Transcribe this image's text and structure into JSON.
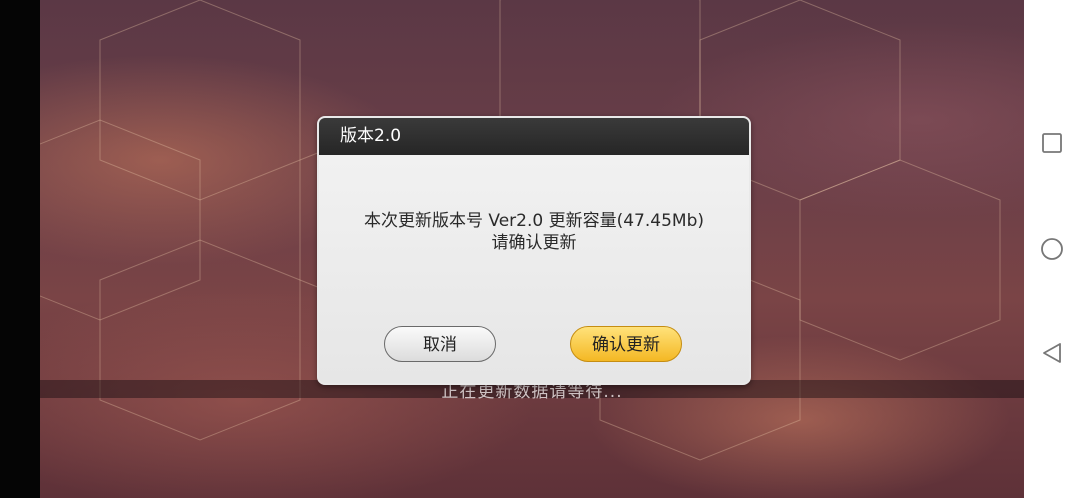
{
  "dialog": {
    "title": "版本2.0",
    "message_line1": "本次更新版本号 Ver2.0 更新容量(47.45Mb)",
    "message_line2": "请确认更新",
    "cancel_label": "取消",
    "confirm_label": "确认更新"
  },
  "status": {
    "loading_text": "正在更新数据请等待..."
  },
  "nav_bar": {
    "recent_icon": "square-icon",
    "home_icon": "circle-icon",
    "back_icon": "triangle-back-icon"
  },
  "colors": {
    "confirm_button": "#f4c430",
    "dialog_header": "#2e2e2e"
  }
}
